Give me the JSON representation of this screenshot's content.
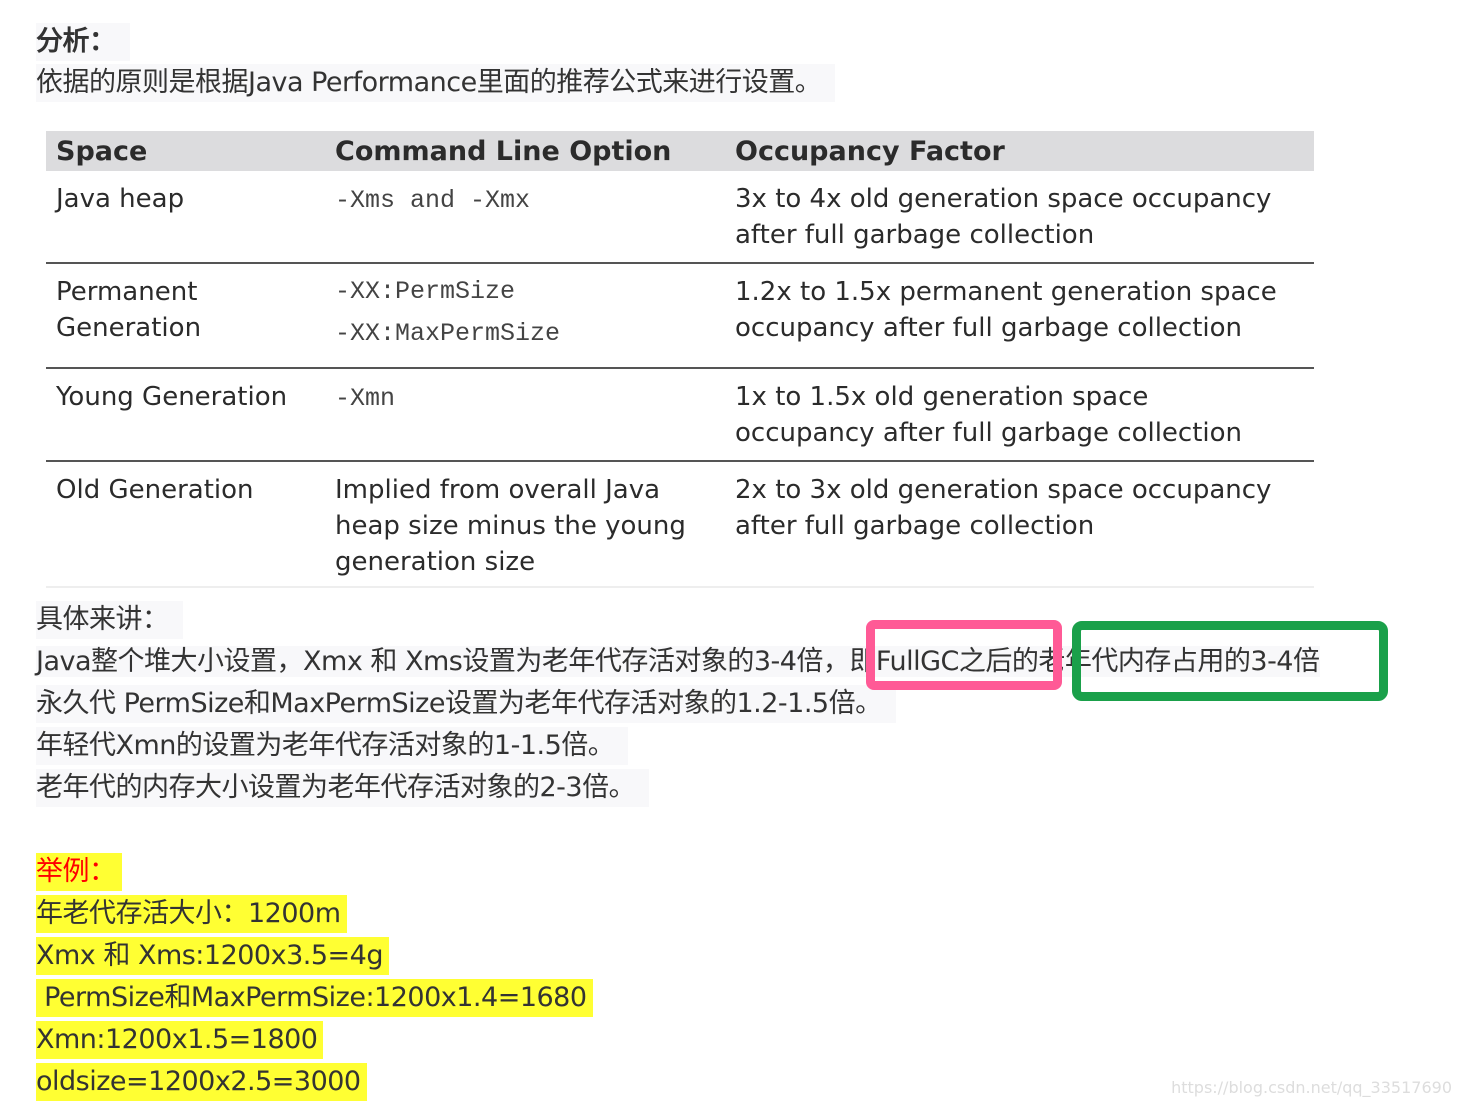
{
  "heading": "分析：",
  "intro": "依据的原则是根据Java Performance里面的推荐公式来进行设置。",
  "table": {
    "headers": [
      "Space",
      "Command Line Option",
      "Occupancy Factor"
    ],
    "rows": [
      {
        "space": "Java heap",
        "options": [
          "-Xms and -Xmx"
        ],
        "factor": [
          "3x to 4x old generation space occupancy",
          "after full garbage collection"
        ]
      },
      {
        "space": "Permanent Generation",
        "space_lines": [
          "Permanent",
          "Generation"
        ],
        "options": [
          "-XX:PermSize",
          "-XX:MaxPermSize"
        ],
        "factor": [
          "1.2x to 1.5x permanent generation space",
          "occupancy after full garbage collection"
        ]
      },
      {
        "space": "Young Generation",
        "options": [
          "-Xmn"
        ],
        "factor": [
          "1x to 1.5x old generation space",
          "occupancy after full garbage collection"
        ]
      },
      {
        "space": "Old Generation",
        "options_text": [
          "Implied from overall Java",
          "heap size minus the young",
          "generation size"
        ],
        "factor": [
          "2x to 3x old generation space occupancy",
          "after full garbage collection"
        ]
      }
    ]
  },
  "details": {
    "title": "具体来讲：",
    "lines": [
      {
        "before": "Java整个堆大小设置，Xmx 和 Xms设置为老年代存活对象的3-4倍，",
        "pink_part": "即FullGC之后的",
        "green_part": "老年代内存占用的3-4倍"
      },
      {
        "text": "永久代 PermSize和MaxPermSize设置为老年代存活对象的1.2-1.5倍。"
      },
      {
        "text": "年轻代Xmn的设置为老年代存活对象的1-1.5倍。"
      },
      {
        "text": "老年代的内存大小设置为老年代存活对象的2-3倍。"
      }
    ]
  },
  "example": {
    "title": "举例：",
    "lines": [
      "年老代存活大小：1200m",
      "Xmx 和 Xms:1200x3.5=4g",
      " PermSize和MaxPermSize:1200x1.4=1680",
      "Xmn:1200x1.5=1800",
      "oldsize=1200x2.5=3000"
    ]
  },
  "annotations": {
    "pink_box_color": "#ff5a96",
    "green_box_color": "#1aa04a",
    "highlight_color": "#ffff33",
    "example_title_color": "#ff0000"
  },
  "watermark": "https://blog.csdn.net/qq_33517690"
}
